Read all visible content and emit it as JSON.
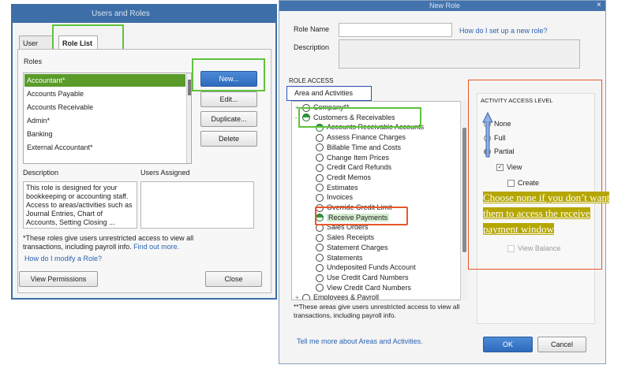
{
  "users_roles": {
    "title": "Users and Roles",
    "tabs": [
      "User List",
      "Role List"
    ],
    "roles_label": "Roles",
    "roles": [
      "Accountant*",
      "Accounts Payable",
      "Accounts Receivable",
      "Admin*",
      "Banking",
      "External Accountant*"
    ],
    "buttons": {
      "new": "New...",
      "edit": "Edit...",
      "duplicate": "Duplicate...",
      "delete": "Delete"
    },
    "description_label": "Description",
    "users_assigned_label": "Users Assigned",
    "description_text": "This role is designed for your bookkeeping or accounting staff. Access to areas/activities such as Journal Entries, Chart of Accounts, Setting Closing ...",
    "note": "*These roles give users unrestricted access to view all transactions, including payroll info.",
    "find_out_more": "Find out more.",
    "modify_link": "How do I modify a Role?",
    "view_permissions": "View Permissions",
    "close": "Close"
  },
  "new_role": {
    "title": "New Role",
    "close_glyph": "×",
    "role_name_label": "Role Name",
    "role_name_value": "",
    "setup_link": "How do I set up a new role?",
    "description_label": "Description",
    "description_value": "",
    "role_access_label": "ROLE ACCESS",
    "area_header": "Area and Activities",
    "tree": [
      {
        "label": "Company**",
        "level": 0,
        "expander": "+",
        "state": "empty"
      },
      {
        "label": "Customers & Receivables",
        "level": 0,
        "expander": "-",
        "state": "partial"
      },
      {
        "label": "Accounts Receivable Accounts",
        "level": 1,
        "state": "partial"
      },
      {
        "label": "Assess Finance Charges",
        "level": 1,
        "state": "empty"
      },
      {
        "label": "Billable Time and Costs",
        "level": 1,
        "state": "empty"
      },
      {
        "label": "Change Item Prices",
        "level": 1,
        "state": "empty"
      },
      {
        "label": "Credit Card Refunds",
        "level": 1,
        "state": "empty"
      },
      {
        "label": "Credit Memos",
        "level": 1,
        "state": "empty"
      },
      {
        "label": "Estimates",
        "level": 1,
        "state": "empty"
      },
      {
        "label": "Invoices",
        "level": 1,
        "state": "empty"
      },
      {
        "label": "Override Credit Limit",
        "level": 1,
        "state": "empty"
      },
      {
        "label": "Receive Payments",
        "level": 1,
        "state": "partial",
        "selected": true
      },
      {
        "label": "Sales Orders",
        "level": 1,
        "state": "empty"
      },
      {
        "label": "Sales Receipts",
        "level": 1,
        "state": "empty"
      },
      {
        "label": "Statement Charges",
        "level": 1,
        "state": "empty"
      },
      {
        "label": "Statements",
        "level": 1,
        "state": "empty"
      },
      {
        "label": "Undeposited Funds Account",
        "level": 1,
        "state": "empty"
      },
      {
        "label": "Use Credit Card Numbers",
        "level": 1,
        "state": "empty"
      },
      {
        "label": "View Credit Card Numbers",
        "level": 1,
        "state": "empty"
      },
      {
        "label": "Employees & Payroll",
        "level": 0,
        "expander": "+",
        "state": "empty"
      }
    ],
    "tree_note": "**These areas give users unrestricted access to view all transactions, including payroll info.",
    "access_level_title": "ACTIVITY ACCESS LEVEL",
    "levels": {
      "none": "None",
      "full": "Full",
      "partial": "Partial"
    },
    "checks": {
      "view": "View",
      "create": "Create",
      "view_balance": "View Balance"
    },
    "tell_more": "Tell me more about Areas and Activities.",
    "ok": "OK",
    "cancel": "Cancel"
  },
  "annotation": "Choose none if you don’t want them to access the receive payment window",
  "colors": {
    "green_highlight": "#5fc23b",
    "orange_highlight": "#e8572a",
    "blue_highlight": "#2a4fb0",
    "annotation_bg": "#b5a600"
  }
}
